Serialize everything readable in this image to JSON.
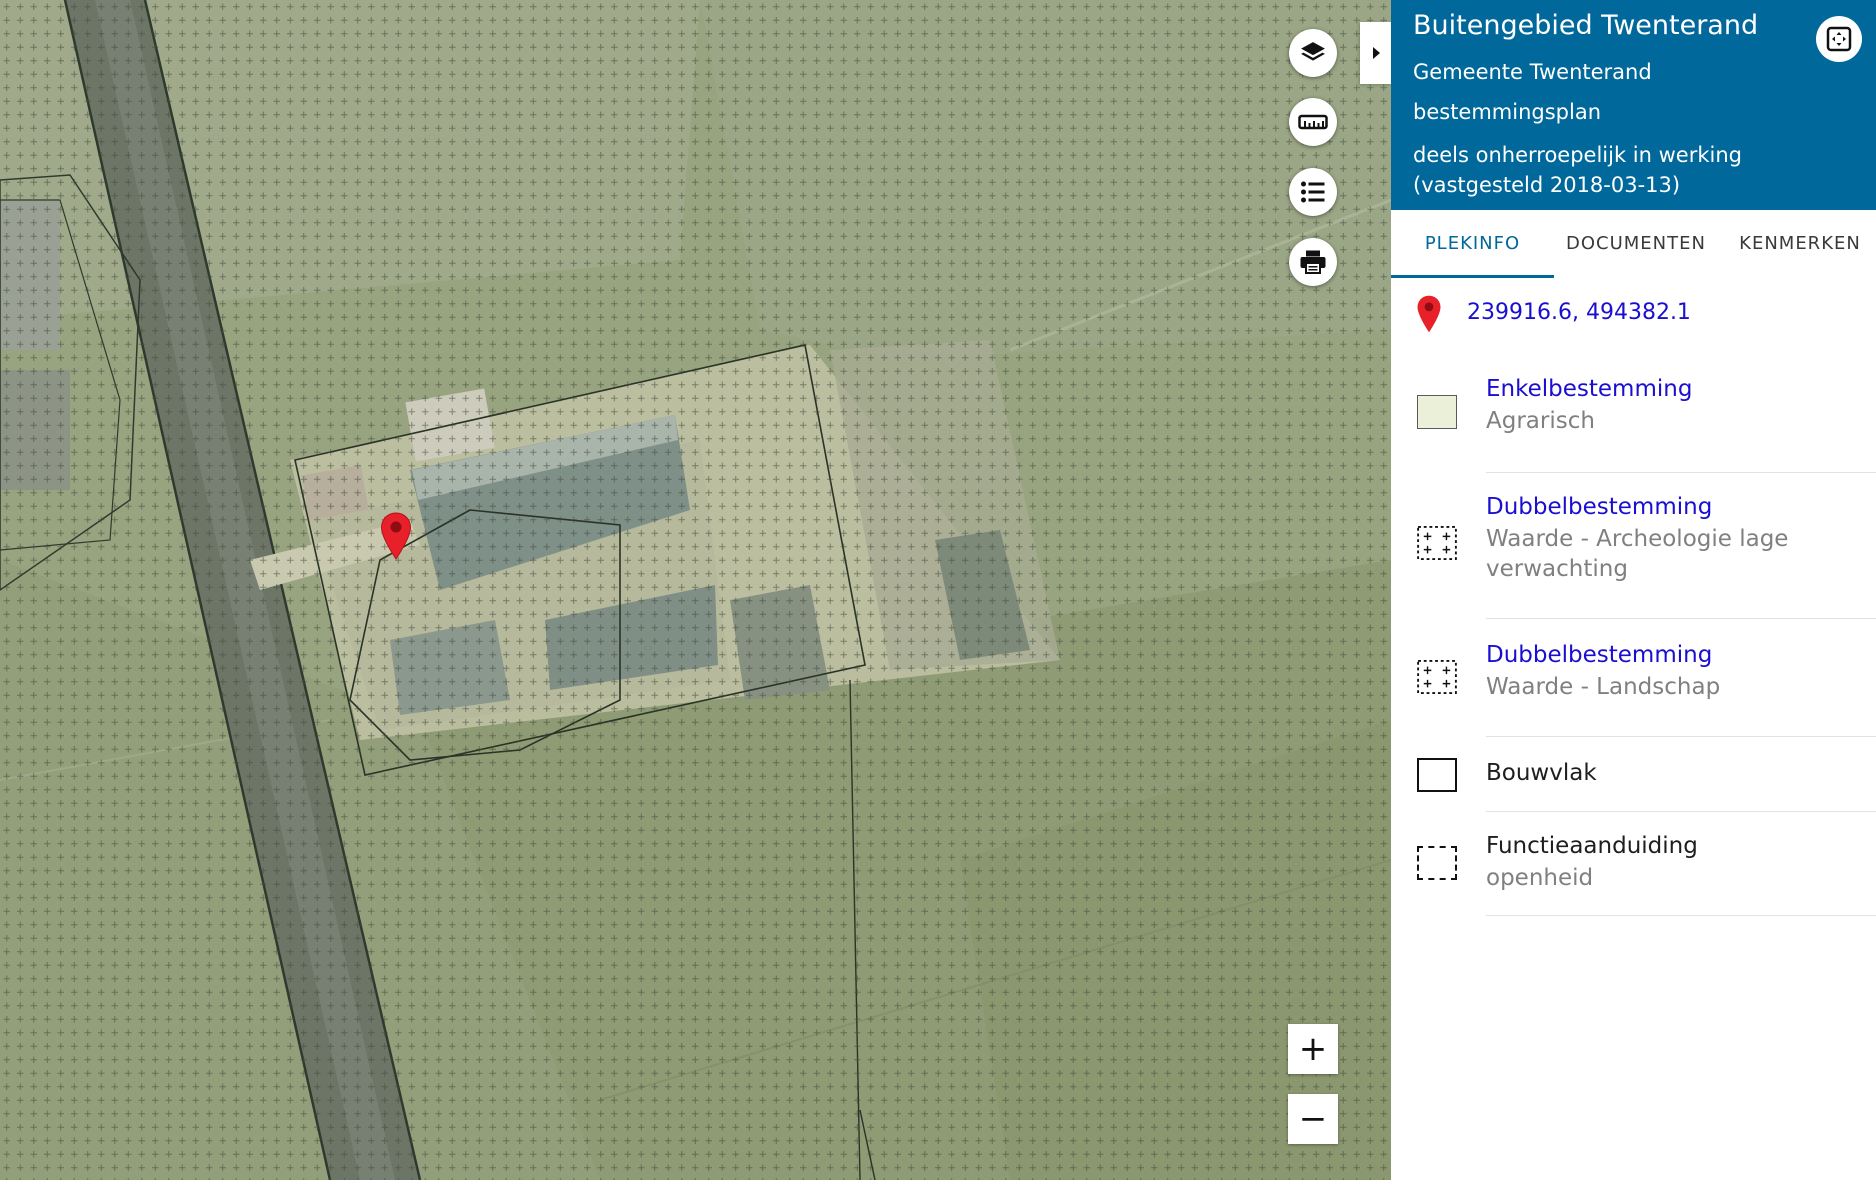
{
  "map": {
    "controls": {
      "layers_icon": "layers-icon",
      "measure_icon": "ruler-icon",
      "legend_icon": "list-icon",
      "print_icon": "printer-icon"
    },
    "zoom_in_label": "+",
    "zoom_out_label": "−",
    "marker_icon": "map-marker-icon",
    "marker_color": "#e8202a"
  },
  "panel": {
    "header": {
      "title": "Buitengebied Twenterand",
      "municipality": "Gemeente Twenterand",
      "plan_type": "bestemmingsplan",
      "status": "deels onherroepelijk in werking (vastgesteld 2018-03-13)",
      "background_color": "#01689b"
    },
    "tabs": [
      {
        "label": "PLEKINFO",
        "active": true
      },
      {
        "label": "DOCUMENTEN",
        "active": false
      },
      {
        "label": "KENMERKEN",
        "active": false
      }
    ],
    "coordinates": "239916.6, 494382.1",
    "legend": [
      {
        "title": "Enkelbestemming",
        "subtitle": "Agrarisch",
        "swatch": "filled-green",
        "link": true
      },
      {
        "title": "Dubbelbestemming",
        "subtitle": "Waarde - Archeologie lage verwachting",
        "swatch": "crosses",
        "link": true
      },
      {
        "title": "Dubbelbestemming",
        "subtitle": "Waarde - Landschap",
        "swatch": "crosses",
        "link": true
      },
      {
        "title": "Bouwvlak",
        "subtitle": "",
        "swatch": "outline",
        "link": false
      },
      {
        "title": "Functieaanduiding",
        "subtitle": "openheid",
        "swatch": "dashed",
        "link": false
      }
    ]
  }
}
